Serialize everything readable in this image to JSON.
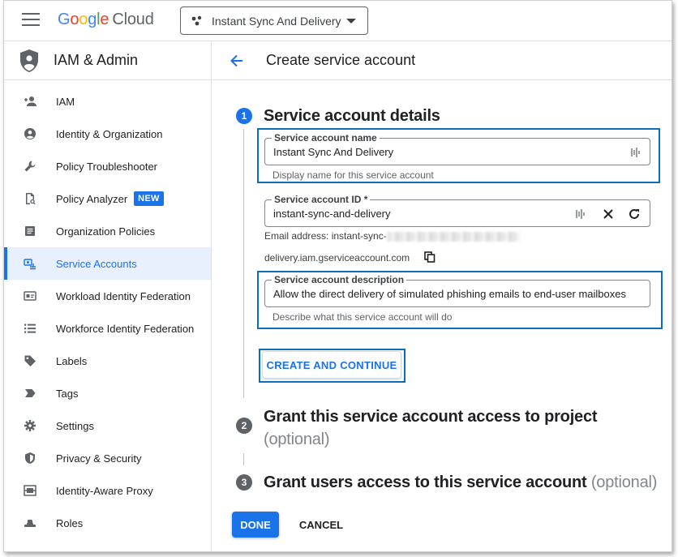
{
  "topbar": {
    "logo": {
      "g1": "G",
      "g2": "o",
      "g3": "o",
      "g4": "g",
      "g5": "l",
      "g6": "e",
      "cloud": "Cloud"
    },
    "project": "Instant Sync And Delivery"
  },
  "sidebar": {
    "title": "IAM & Admin",
    "items": [
      {
        "label": "IAM",
        "icon": "person-add-icon"
      },
      {
        "label": "Identity & Organization",
        "icon": "account-circle-icon"
      },
      {
        "label": "Policy Troubleshooter",
        "icon": "wrench-icon"
      },
      {
        "label": "Policy Analyzer",
        "icon": "document-search-icon",
        "badge": "NEW"
      },
      {
        "label": "Organization Policies",
        "icon": "article-icon"
      },
      {
        "label": "Service Accounts",
        "icon": "service-account-icon",
        "active": true
      },
      {
        "label": "Workload Identity Federation",
        "icon": "id-card-icon"
      },
      {
        "label": "Workforce Identity Federation",
        "icon": "list-icon"
      },
      {
        "label": "Labels",
        "icon": "label-tag-icon"
      },
      {
        "label": "Tags",
        "icon": "tag-chevron-icon"
      },
      {
        "label": "Settings",
        "icon": "gear-icon"
      },
      {
        "label": "Privacy & Security",
        "icon": "shield-lock-icon"
      },
      {
        "label": "Identity-Aware Proxy",
        "icon": "proxy-icon"
      },
      {
        "label": "Roles",
        "icon": "roles-hat-icon"
      }
    ]
  },
  "main": {
    "title": "Create service account",
    "step1": {
      "number": "1",
      "title": "Service account details",
      "name_field": {
        "label": "Service account name",
        "value": "Instant Sync And Delivery",
        "hint": "Display name for this service account"
      },
      "id_field": {
        "label": "Service account ID *",
        "value": "instant-sync-and-delivery"
      },
      "email_prefix": "Email address: instant-sync-",
      "email_suffix": "delivery.iam.gserviceaccount.com",
      "desc_field": {
        "label": "Service account description",
        "value": "Allow the direct delivery of simulated phishing emails to end-user mailboxes",
        "hint": "Describe what this service account will do"
      },
      "create_button": "CREATE AND CONTINUE"
    },
    "step2": {
      "number": "2",
      "title": "Grant this service account access to project",
      "optional": "(optional)"
    },
    "step3": {
      "number": "3",
      "title": "Grant users access to this service account",
      "optional": "(optional)"
    },
    "done_button": "DONE",
    "cancel_button": "CANCEL"
  },
  "colors": {
    "accent": "#1a73e8",
    "highlight_box": "#0b6ebd",
    "active_bg": "#e8f0fe"
  }
}
